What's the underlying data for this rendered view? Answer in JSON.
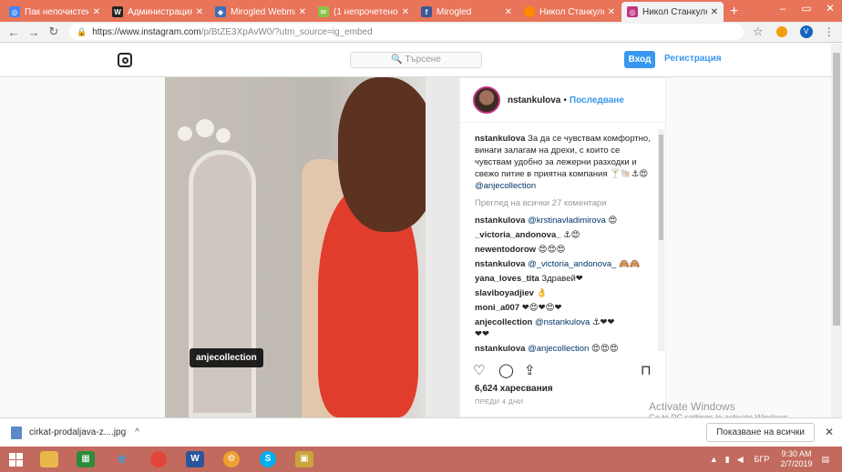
{
  "browser": {
    "tabs": [
      {
        "title": "Пак непочистени",
        "favicon_color": "#4285f4",
        "glyph": "◎"
      },
      {
        "title": "Администрация -",
        "favicon_color": "#222222",
        "glyph": "W"
      },
      {
        "title": "Mirogled Webmail",
        "favicon_color": "#3b6fb6",
        "glyph": "◆"
      },
      {
        "title": "(1 непрочетено) -",
        "favicon_color": "#8bc34a",
        "glyph": "✉"
      },
      {
        "title": "Mirogled",
        "favicon_color": "#3b5998",
        "glyph": "f"
      },
      {
        "title": "Никол Станкулова",
        "favicon_color": "#ff8a00",
        "glyph": "●"
      },
      {
        "title": "Никол Станкулова",
        "favicon_color": "#c13584",
        "glyph": "◎"
      }
    ],
    "new_tab_label": "+",
    "url_host": "https://www.instagram.com",
    "url_rest": "/p/BtZE3XpAvW0/?utm_source=ig_embed",
    "profile_initial": "V"
  },
  "instagram": {
    "search_placeholder": "🔍 Търсене",
    "login_label": "Вход",
    "register_label": "Регистрация",
    "post": {
      "photo_tag": "anjecollection",
      "username": "nstankulova",
      "follow_label": "Последване",
      "caption_user": "nstankulova",
      "caption_text": "За да се чувствам комфортно, винаги залагам на дрехи, с които се чувствам удобно за лежерни разходки и свежо питие в приятна компания 🍸🐚⚓😍",
      "caption_mention": "@anjecollection",
      "view_all_label": "Преглед на всички 27 коментари",
      "comments": [
        {
          "user": "nstankulova",
          "mention": "@krstinavladimirova",
          "text": " 😍"
        },
        {
          "user": "_victoria_andonova_",
          "mention": "",
          "text": " ⚓😍"
        },
        {
          "user": "newentodorow",
          "mention": "",
          "text": " 😍😍😍"
        },
        {
          "user": "nstankulova",
          "mention": "@_victoria_andonova_",
          "text": " 🙈🙈"
        },
        {
          "user": "yana_loves_tita",
          "mention": "",
          "text": " Здравей❤"
        },
        {
          "user": "slaviboyadjiev",
          "mention": "",
          "text": " 👌"
        },
        {
          "user": "moni_a007",
          "mention": "",
          "text": " ❤😍❤😍❤"
        },
        {
          "user": "anjecollection",
          "mention": "@nstankulova",
          "text": " ⚓❤❤"
        },
        {
          "user": "",
          "mention": "",
          "text": "❤❤"
        },
        {
          "user": "nstankulova",
          "mention": "@anjecollection",
          "text": " 😍😍😍"
        }
      ],
      "likes": "6,624 харесвания",
      "time": "ПРЕДИ 4 ДНИ"
    }
  },
  "windows": {
    "activate_title": "Activate Windows",
    "activate_sub": "Go to PC settings to activate Windows."
  },
  "downloads": {
    "file_name": "cirkat-prodaljava-z....jpg",
    "show_all_label": "Показване на всички"
  },
  "taskbar": {
    "language": "БГР",
    "time": "9:30 AM",
    "date": "2/7/2019"
  },
  "colors": {
    "accent_blue": "#3897f0",
    "tab_strip": "#e8745a",
    "taskbar": "#c26a5e"
  }
}
